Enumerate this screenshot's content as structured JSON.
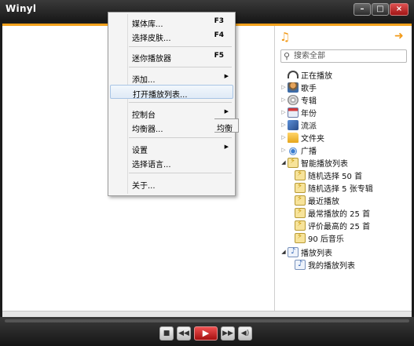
{
  "window": {
    "title": "Winyl",
    "minimize_label": "–",
    "maximize_label": "□",
    "close_label": "×"
  },
  "right_pane": {
    "search_placeholder": "搜索全部"
  },
  "tree": [
    {
      "label": "正在播放",
      "icon": "headphones-icon",
      "expander": ""
    },
    {
      "label": "歌手",
      "icon": "artist-icon",
      "expander": "▷"
    },
    {
      "label": "专辑",
      "icon": "album-disc-icon",
      "expander": "▷"
    },
    {
      "label": "年份",
      "icon": "calendar-icon",
      "expander": "▷"
    },
    {
      "label": "流派",
      "icon": "genre-icon",
      "expander": "▷"
    },
    {
      "label": "文件夹",
      "icon": "folder-icon",
      "expander": "▷"
    },
    {
      "label": "广播",
      "icon": "radio-icon",
      "expander": "▷"
    },
    {
      "label": "智能播放列表",
      "icon": "smartlist-icon",
      "expander": "◢"
    },
    {
      "label": "随机选择 50 首",
      "icon": "smartlist-icon",
      "expander": ""
    },
    {
      "label": "随机选择 5 张专辑",
      "icon": "smartlist-icon",
      "expander": ""
    },
    {
      "label": "最近播放",
      "icon": "smartlist-icon",
      "expander": ""
    },
    {
      "label": "最常播放的 25 首",
      "icon": "smartlist-icon",
      "expander": ""
    },
    {
      "label": "评价最高的 25 首",
      "icon": "smartlist-icon",
      "expander": ""
    },
    {
      "label": "90 后音乐",
      "icon": "smartlist-icon",
      "expander": ""
    },
    {
      "label": "播放列表",
      "icon": "playlist-icon",
      "expander": "◢"
    },
    {
      "label": "我的播放列表",
      "icon": "playlist-icon",
      "expander": ""
    }
  ],
  "menu": {
    "items": [
      {
        "label": "媒体库...",
        "shortcut": "F3",
        "submenu": ""
      },
      {
        "label": "选择皮肤...",
        "shortcut": "F4",
        "submenu": ""
      },
      {
        "label": "迷你播放器",
        "shortcut": "F5",
        "submenu": ""
      },
      {
        "label": "添加...",
        "shortcut": "",
        "submenu": "▶"
      },
      {
        "label": "打开播放列表...",
        "shortcut": "",
        "submenu": ""
      },
      {
        "label": "控制台",
        "shortcut": "",
        "submenu": "▶"
      },
      {
        "label": "均衡器...",
        "shortcut": "",
        "submenu": ""
      },
      {
        "label": "设置",
        "shortcut": "",
        "submenu": "▶"
      },
      {
        "label": "选择语言...",
        "shortcut": "",
        "submenu": ""
      },
      {
        "label": "关于...",
        "shortcut": "",
        "submenu": ""
      }
    ],
    "submenu_fragment": "均衡"
  },
  "controls": {
    "stop": "■",
    "prev": "◀◀",
    "play": "▶",
    "next": "▶▶",
    "volume": "◀)"
  },
  "colors": {
    "accent": "#f3a21c",
    "play_button": "#d42a2a"
  }
}
